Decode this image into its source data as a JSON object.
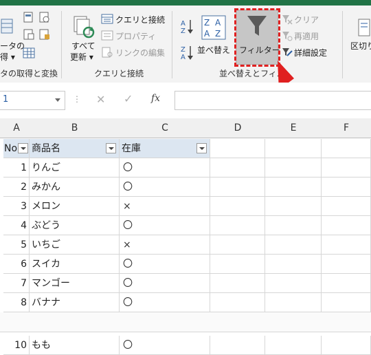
{
  "ribbon": {
    "get_data_lines": [
      "ータの",
      "得 ▾"
    ],
    "get_transform_label": "タの取得と変換",
    "refresh_all_lines": [
      "すべて",
      "更新 ▾"
    ],
    "queries_connections_btn": "クエリと接続",
    "properties_btn": "プロパティ",
    "edit_links_btn": "リンクの編集",
    "queries_group_label": "クエリと接続",
    "sort_btn": "並べ替え",
    "sort_group_label": "並べ替えとフィルター",
    "filter_btn": "フィルター",
    "clear_btn": "クリア",
    "reapply_btn": "再適用",
    "advanced_btn": "詳細設定",
    "text_to_columns_btn": "区切り"
  },
  "formula_bar": {
    "name_box": "1",
    "fx": "fx",
    "formula": ""
  },
  "columns": [
    "A",
    "B",
    "C",
    "D",
    "E",
    "F"
  ],
  "table": {
    "headers": [
      "No",
      "商品名",
      "在庫"
    ],
    "rows": [
      {
        "no": "1",
        "name": "りんご",
        "stock": "〇"
      },
      {
        "no": "2",
        "name": "みかん",
        "stock": "〇"
      },
      {
        "no": "3",
        "name": "メロン",
        "stock": "×"
      },
      {
        "no": "4",
        "name": "ぶどう",
        "stock": "〇"
      },
      {
        "no": "5",
        "name": "いちご",
        "stock": "×"
      },
      {
        "no": "6",
        "name": "スイカ",
        "stock": "〇"
      },
      {
        "no": "7",
        "name": "マンゴー",
        "stock": "〇"
      },
      {
        "no": "8",
        "name": "バナナ",
        "stock": "〇"
      }
    ],
    "partial_row": {
      "no": "10",
      "name": "もも",
      "stock": "〇"
    }
  },
  "colors": {
    "accent_green": "#217346",
    "highlight_red": "#e02020",
    "header_fill": "#dce6f1"
  }
}
